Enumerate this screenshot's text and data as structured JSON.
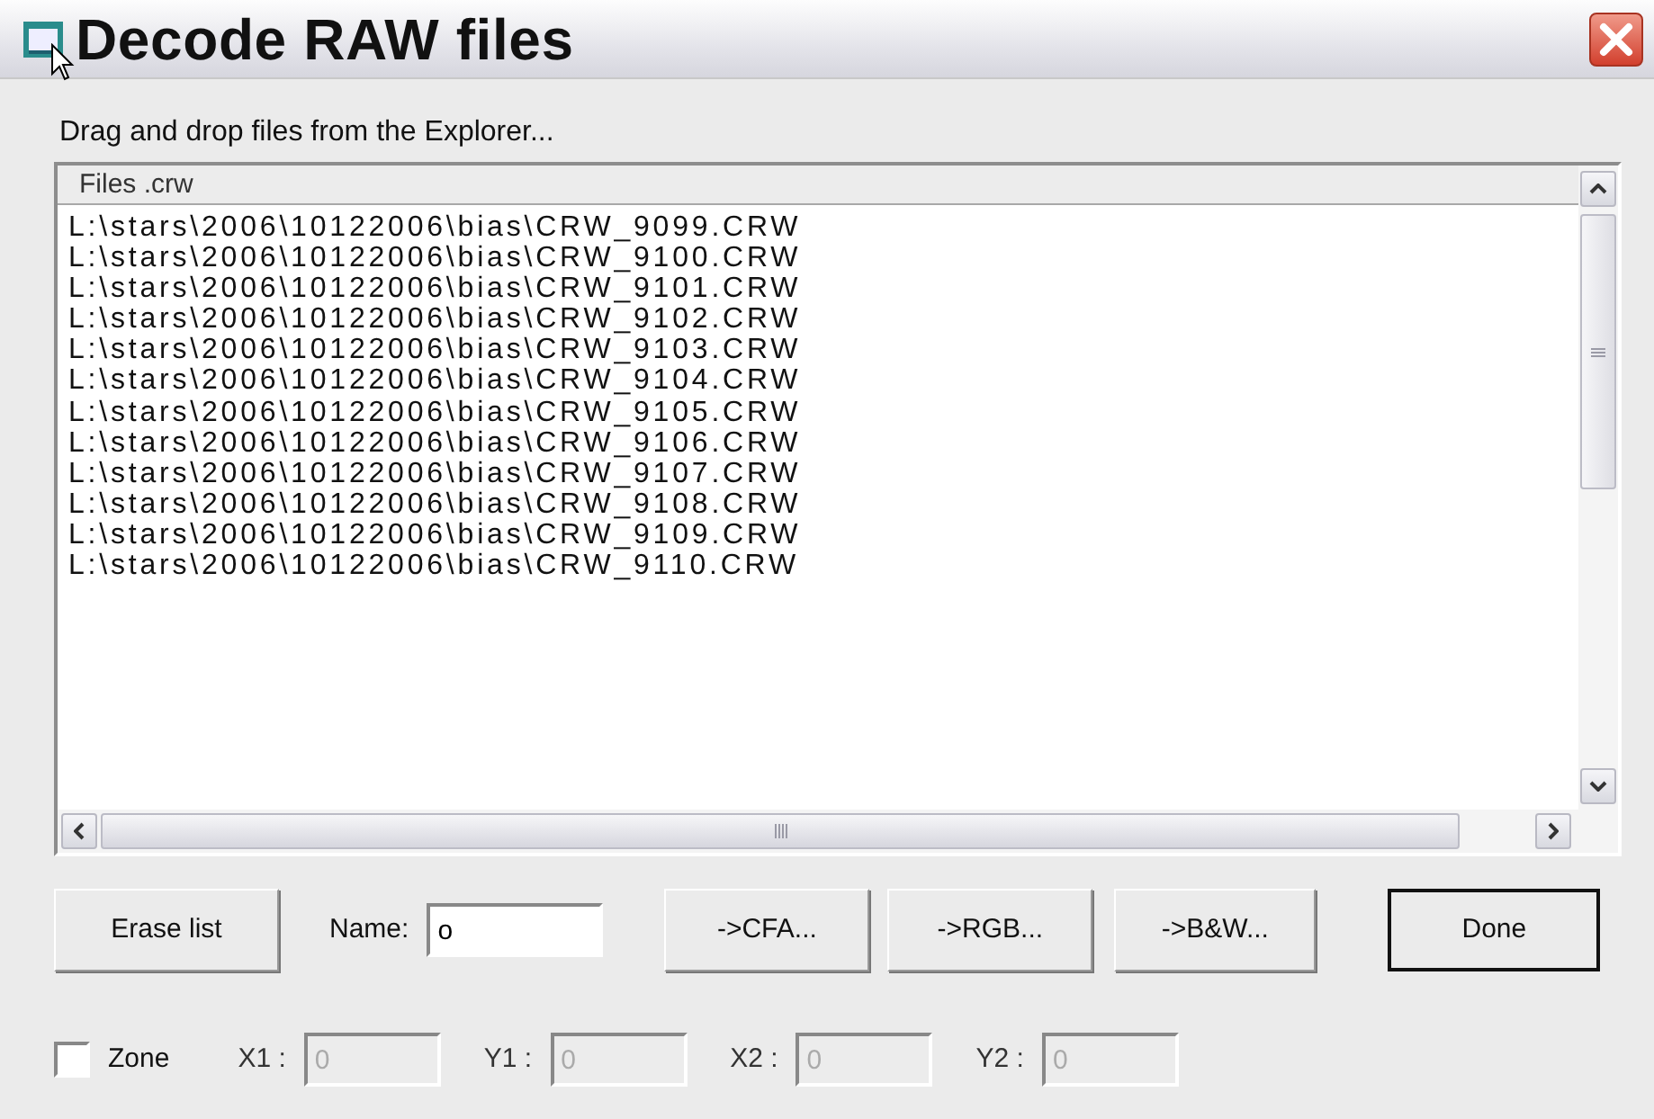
{
  "window": {
    "title": "Decode RAW files"
  },
  "instruction": "Drag and drop files from the Explorer...",
  "file_list": {
    "header": "Files .crw",
    "rows": [
      "L:\\stars\\2006\\10122006\\bias\\CRW_9099.CRW",
      "L:\\stars\\2006\\10122006\\bias\\CRW_9100.CRW",
      "L:\\stars\\2006\\10122006\\bias\\CRW_9101.CRW",
      "L:\\stars\\2006\\10122006\\bias\\CRW_9102.CRW",
      "L:\\stars\\2006\\10122006\\bias\\CRW_9103.CRW",
      "L:\\stars\\2006\\10122006\\bias\\CRW_9104.CRW",
      "L:\\stars\\2006\\10122006\\bias\\CRW_9105.CRW",
      "L:\\stars\\2006\\10122006\\bias\\CRW_9106.CRW",
      "L:\\stars\\2006\\10122006\\bias\\CRW_9107.CRW",
      "L:\\stars\\2006\\10122006\\bias\\CRW_9108.CRW",
      "L:\\stars\\2006\\10122006\\bias\\CRW_9109.CRW",
      "L:\\stars\\2006\\10122006\\bias\\CRW_9110.CRW"
    ]
  },
  "toolbar": [
    {
      "kind": "button",
      "label": "Erase list",
      "default": false
    },
    {
      "kind": "field",
      "label": "Name:",
      "value": "o"
    },
    {
      "kind": "button",
      "label": "->CFA...",
      "default": false
    },
    {
      "kind": "button",
      "label": "->RGB...",
      "default": false
    },
    {
      "kind": "button",
      "label": "->B&W...",
      "default": false
    },
    {
      "kind": "button",
      "label": "Done",
      "default": true
    }
  ],
  "zone": {
    "label": "Zone",
    "checked": false
  },
  "coordinates": [
    {
      "label": "X1 :",
      "value": "0",
      "disabled": true
    },
    {
      "label": "Y1 :",
      "value": "0",
      "disabled": true
    },
    {
      "label": "X2 :",
      "value": "0",
      "disabled": true
    },
    {
      "label": "Y2 :",
      "value": "0",
      "disabled": true
    }
  ]
}
